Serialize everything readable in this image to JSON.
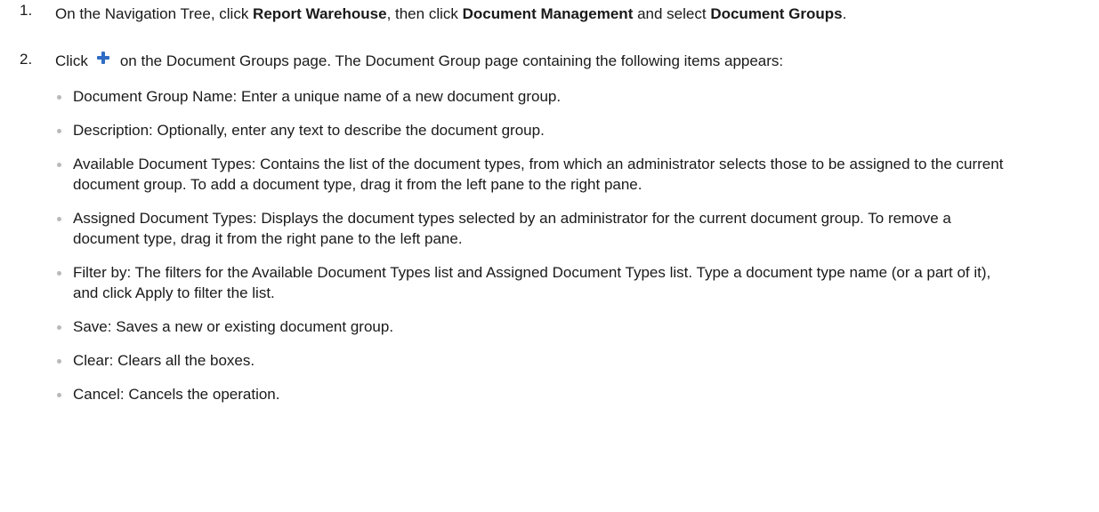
{
  "step1": {
    "number": "1.",
    "text_a": "On the Navigation Tree, click ",
    "bold_a": "Report Warehouse",
    "text_b": ", then click ",
    "bold_b": "Document Management",
    "text_c": " and select ",
    "bold_c": "Document Groups",
    "text_d": "."
  },
  "step2": {
    "number": "2.",
    "text_before_icon": "Click",
    "icon": "plus-icon",
    "icon_color": "#2f6cc4",
    "text_after_icon": "on the Document Groups page. The Document Group page containing the following items appears:"
  },
  "items": [
    "Document Group Name: Enter a unique name of a new document group.",
    "Description: Optionally, enter any text to describe the document group.",
    "Available Document Types: Contains the list of the document types, from which an administrator selects those to be assigned to the current document group. To add a document type, drag it from the left pane to the right pane.",
    "Assigned Document Types: Displays the document types selected by an administrator for the current document group. To remove a document type, drag it from the right pane to the left pane.",
    "Filter by: The filters for the Available Document Types list and Assigned Document Types list. Type a document type name (or a part of it), and click Apply to filter the list.",
    "Save: Saves a new or existing document group.",
    "Clear: Clears all the boxes.",
    "Cancel: Cancels the operation."
  ]
}
